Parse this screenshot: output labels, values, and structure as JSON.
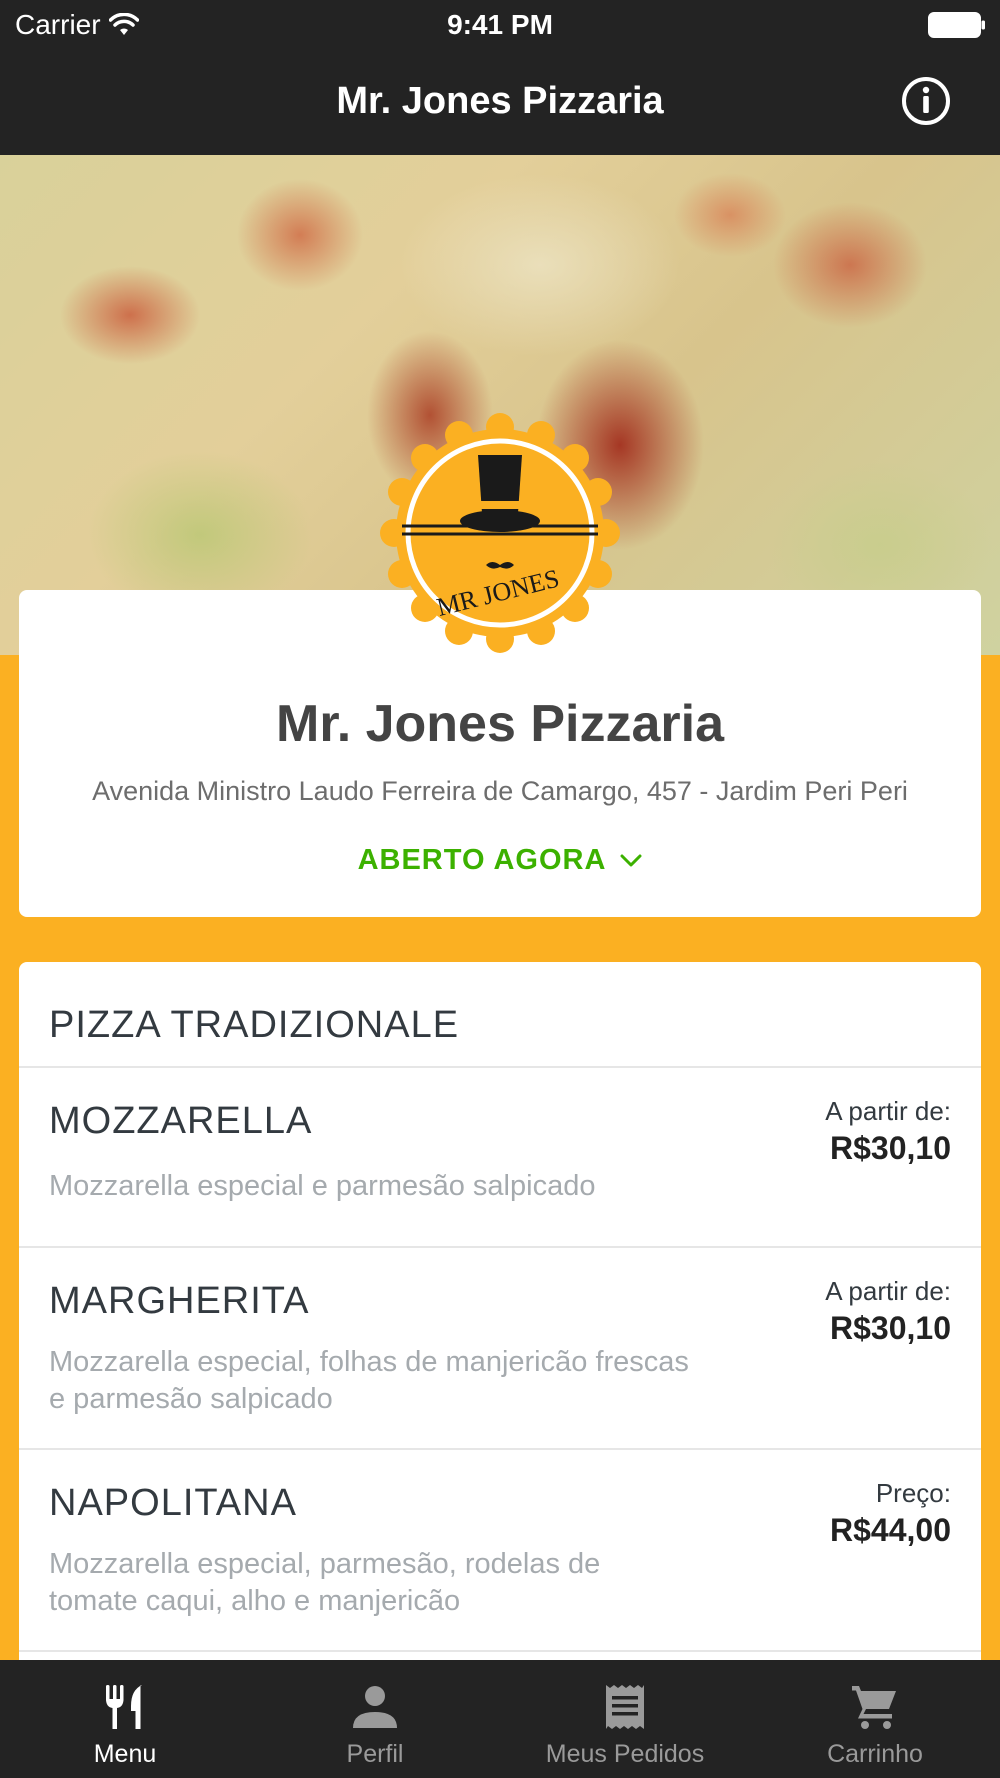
{
  "status_bar": {
    "carrier": "Carrier",
    "time": "9:41 PM"
  },
  "nav": {
    "title": "Mr. Jones Pizzaria",
    "info_icon": "info-icon"
  },
  "store": {
    "name": "Mr. Jones Pizzaria",
    "address": "Avenida Ministro Laudo Ferreira de Camargo, 457 - Jardim Peri Peri",
    "status": "ABERTO AGORA",
    "logo_text": "MR JONES"
  },
  "menu": {
    "section_title": "PIZZA TRADIZIONALE",
    "items": [
      {
        "name": "MOZZARELLA",
        "description": "Mozzarella especial e parmesão salpicado",
        "price_label": "A partir de:",
        "price": "R$30,10"
      },
      {
        "name": "MARGHERITA",
        "description": "Mozzarella especial, folhas de manjericão frescas e parmesão salpicado",
        "price_label": "A partir de:",
        "price": "R$30,10"
      },
      {
        "name": "NAPOLITANA",
        "description": "Mozzarella especial, parmesão, rodelas de tomate caqui, alho e manjericão",
        "price_label": "Preço:",
        "price": "R$44,00"
      }
    ]
  },
  "tabs": [
    {
      "label": "Menu",
      "icon": "fork-knife-icon",
      "active": true
    },
    {
      "label": "Perfil",
      "icon": "person-icon",
      "active": false
    },
    {
      "label": "Meus Pedidos",
      "icon": "receipt-icon",
      "active": false
    },
    {
      "label": "Carrinho",
      "icon": "cart-icon",
      "active": false
    }
  ],
  "colors": {
    "accent": "#fbb022",
    "bar": "#232323",
    "open": "#3cb100"
  }
}
